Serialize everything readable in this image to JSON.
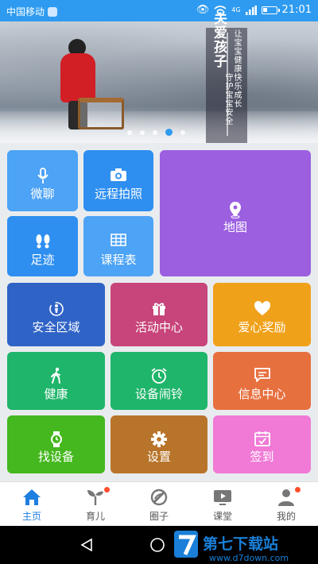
{
  "status_bar": {
    "carrier": "中国移动",
    "net": "4G",
    "time": "21:01"
  },
  "banner": {
    "title": "关爱孩子",
    "subtitle1": "让宝宝健康快乐成长",
    "subtitle2": "守护宝宝安全",
    "pages": 5,
    "active_page": 4
  },
  "tiles": [
    {
      "label": "微聊",
      "icon": "mic-icon",
      "color": "#4da3f5"
    },
    {
      "label": "远程拍照",
      "icon": "camera-icon",
      "color": "#2e8ff0"
    },
    {
      "label": "地图",
      "icon": "map-pin-icon",
      "color": "#9b5fe0"
    },
    {
      "label": "足迹",
      "icon": "footprints-icon",
      "color": "#2e8ff0"
    },
    {
      "label": "课程表",
      "icon": "calendar-grid-icon",
      "color": "#4da3f5"
    },
    {
      "label": "安全区域",
      "icon": "safe-zone-icon",
      "color": "#2f63c6"
    },
    {
      "label": "活动中心",
      "icon": "gift-icon",
      "color": "#c7457a"
    },
    {
      "label": "爱心奖励",
      "icon": "heart-icon",
      "color": "#f0a11a"
    },
    {
      "label": "健康",
      "icon": "walking-icon",
      "color": "#1fb56a"
    },
    {
      "label": "设备闹铃",
      "icon": "alarm-clock-icon",
      "color": "#1fb56a"
    },
    {
      "label": "信息中心",
      "icon": "message-icon",
      "color": "#e7703f"
    },
    {
      "label": "找设备",
      "icon": "watch-icon",
      "color": "#45b81f"
    },
    {
      "label": "设置",
      "icon": "gear-icon",
      "color": "#b8742a"
    },
    {
      "label": "签到",
      "icon": "checkin-calendar-icon",
      "color": "#f07ad6"
    }
  ],
  "bottom_nav": [
    {
      "label": "主页",
      "icon": "home-icon",
      "active": true,
      "badge": false
    },
    {
      "label": "育儿",
      "icon": "sprout-icon",
      "active": false,
      "badge": true
    },
    {
      "label": "圈子",
      "icon": "circle-slash-icon",
      "active": false,
      "badge": false
    },
    {
      "label": "课堂",
      "icon": "video-play-icon",
      "active": false,
      "badge": false
    },
    {
      "label": "我的",
      "icon": "person-icon",
      "active": false,
      "badge": true
    }
  ],
  "watermark": {
    "brand": "第七下载站",
    "url": "www.d7down.com"
  },
  "colors": {
    "primary": "#2e9bf0",
    "badge": "#ff4d2e"
  }
}
